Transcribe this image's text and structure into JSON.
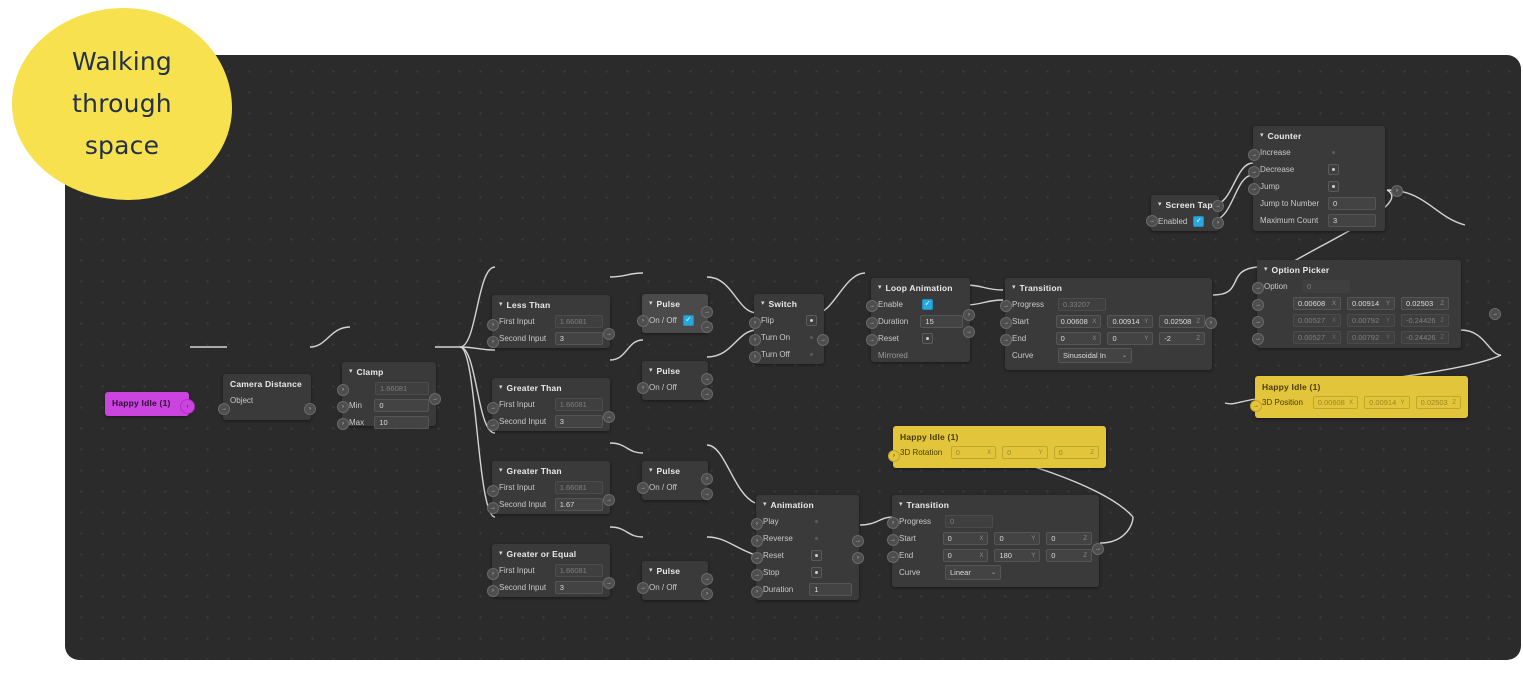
{
  "badge": {
    "line1": "Walking",
    "line2": "through",
    "line3": "space"
  },
  "colors": {
    "canvas_bg": "#2b2b2b",
    "node_bg": "#3a3a3a",
    "node_selected_bg": "#4a4a4a",
    "badge_yellow": "#f7e14f",
    "badge_text": "#23314a",
    "layer_purple": "#cc44e0",
    "layer_yellow": "#e3c53c",
    "checkbox_blue": "#29a8e0"
  },
  "icons": {
    "caret": "▾",
    "chevron_down": "⌄",
    "check": "✓",
    "port_in": "›",
    "port_arrow": "→"
  },
  "nodes": {
    "happy_idle_source": {
      "title": "Happy Idle (1)"
    },
    "camera_distance": {
      "title": "Camera Distance",
      "rows": [
        {
          "label": "Object"
        }
      ]
    },
    "clamp": {
      "title": "Clamp",
      "value": "1.66081",
      "rows": [
        {
          "label": "Min",
          "value": "0"
        },
        {
          "label": "Max",
          "value": "10"
        }
      ]
    },
    "less_than": {
      "title": "Less Than",
      "rows": [
        {
          "label": "First Input",
          "value": "1.66081",
          "dim": true
        },
        {
          "label": "Second Input",
          "value": "3",
          "dim": false
        }
      ]
    },
    "greater_than_1": {
      "title": "Greater Than",
      "rows": [
        {
          "label": "First Input",
          "value": "1.66081",
          "dim": true
        },
        {
          "label": "Second Input",
          "value": "3",
          "dim": false
        }
      ]
    },
    "greater_than_2": {
      "title": "Greater Than",
      "rows": [
        {
          "label": "First Input",
          "value": "1.66081",
          "dim": true
        },
        {
          "label": "Second Input",
          "value": "1.67",
          "dim": false
        }
      ]
    },
    "greater_or_equal": {
      "title": "Greater or Equal",
      "rows": [
        {
          "label": "First Input",
          "value": "1.66081",
          "dim": true
        },
        {
          "label": "Second Input",
          "value": "3",
          "dim": false
        }
      ]
    },
    "pulse_1": {
      "title": "Pulse",
      "label": "On / Off",
      "checked": true
    },
    "pulse_2": {
      "title": "Pulse",
      "label": "On / Off",
      "checked": false
    },
    "pulse_3": {
      "title": "Pulse",
      "label": "On / Off",
      "checked": false
    },
    "pulse_4": {
      "title": "Pulse",
      "label": "On / Off",
      "checked": false
    },
    "switch": {
      "title": "Switch",
      "rows": [
        {
          "label": "Flip",
          "on": true
        },
        {
          "label": "Turn On",
          "on": false
        },
        {
          "label": "Turn Off",
          "on": false
        }
      ]
    },
    "loop_animation": {
      "title": "Loop Animation",
      "enable_label": "Enable",
      "duration_label": "Duration",
      "duration_value": "15",
      "reset_label": "Reset",
      "mirrored_label": "Mirrored"
    },
    "transition_top": {
      "title": "Transition",
      "progress_label": "Progress",
      "progress_value": "0.33207",
      "start_label": "Start",
      "start": [
        "0.00608",
        "0.00914",
        "0.02508"
      ],
      "end_label": "End",
      "end": [
        "0",
        "0",
        "-2"
      ],
      "curve_label": "Curve",
      "curve_value": "Sinusoidal In",
      "axes": [
        "X",
        "Y",
        "Z"
      ]
    },
    "screen_tap": {
      "title": "Screen Tap",
      "enabled_label": "Enabled",
      "enabled": true
    },
    "counter": {
      "title": "Counter",
      "rows": [
        {
          "label": "Increase",
          "on": false
        },
        {
          "label": "Decrease",
          "on": true
        },
        {
          "label": "Jump",
          "on": true
        }
      ],
      "jump_label": "Jump to Number",
      "jump_value": "0",
      "max_label": "Maximum Count",
      "max_value": "3"
    },
    "option_picker": {
      "title": "Option Picker",
      "option_label": "Option",
      "option_value": "0",
      "axes": [
        "X",
        "Y",
        "Z"
      ],
      "options": [
        {
          "values": [
            "0.00608",
            "0.00914",
            "0.02503"
          ],
          "dim": false
        },
        {
          "values": [
            "0.00527",
            "0.00792",
            "-0.24426"
          ],
          "dim": true
        },
        {
          "values": [
            "0.00527",
            "0.00792",
            "-0.24426"
          ],
          "dim": true
        }
      ]
    },
    "happy_idle_position": {
      "title": "Happy Idle (1)",
      "label": "3D Position",
      "values": [
        "0.00608",
        "0.00914",
        "0.02503"
      ],
      "axes": [
        "X",
        "Y",
        "Z"
      ]
    },
    "happy_idle_rotation": {
      "title": "Happy Idle (1)",
      "label": "3D Rotation",
      "values": [
        "0",
        "0",
        "0"
      ],
      "axes": [
        "X",
        "Y",
        "Z"
      ]
    },
    "animation": {
      "title": "Animation",
      "rows": [
        {
          "label": "Play",
          "on": false
        },
        {
          "label": "Reverse",
          "on": false
        },
        {
          "label": "Reset",
          "on": true
        },
        {
          "label": "Stop",
          "on": true
        }
      ],
      "duration_label": "Duration",
      "duration_value": "1"
    },
    "transition_bottom": {
      "title": "Transition",
      "progress_label": "Progress",
      "progress_value": "0",
      "start_label": "Start",
      "start": [
        "0",
        "0",
        "0"
      ],
      "end_label": "End",
      "end": [
        "0",
        "180",
        "0"
      ],
      "curve_label": "Curve",
      "curve_value": "Linear",
      "axes": [
        "X",
        "Y",
        "Z"
      ]
    }
  }
}
